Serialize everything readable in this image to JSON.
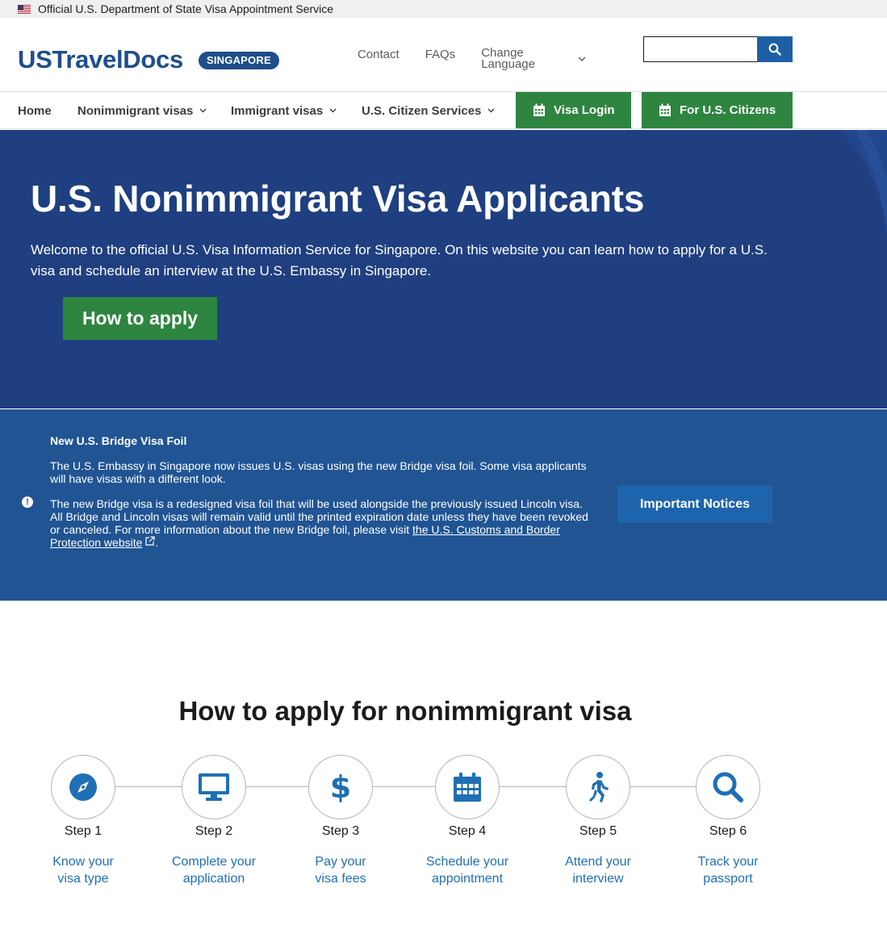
{
  "banner": {
    "text": "Official U.S. Department of State Visa Appointment Service"
  },
  "header": {
    "logo": "USTravelDocs",
    "country": "SINGAPORE",
    "contact": "Contact",
    "faqs": "FAQs",
    "language_line1": "Change",
    "language_line2": "Language",
    "search_value": ""
  },
  "nav": {
    "home": "Home",
    "nonimmigrant": "Nonimmigrant visas",
    "immigrant": "Immigrant visas",
    "citizen_services": "U.S. Citizen Services",
    "visa_login": "Visa Login",
    "for_citizens": "For U.S. Citizens"
  },
  "hero": {
    "title": "U.S. Nonimmigrant Visa Applicants",
    "text": "Welcome to the official U.S. Visa Information Service for Singapore. On this website you can learn how to apply for a U.S. visa and schedule an interview at the U.S. Embassy in Singapore.",
    "button": "How to apply"
  },
  "notice": {
    "heading": "New U.S. Bridge Visa Foil",
    "p1": "The U.S. Embassy in Singapore now issues U.S. visas using the new Bridge visa foil. Some visa applicants will have visas with a different look.",
    "p2": "The new Bridge visa is a redesigned visa foil that will be used alongside the previously issued Lincoln visa. All Bridge and Lincoln visas will remain valid until the printed expiration date unless they have been revoked or canceled. For more information about the new Bridge foil, please visit ",
    "link": "the U.S. Customs and Border Protection website",
    "p2_end": ".",
    "button": "Important Notices"
  },
  "steps": {
    "title": "How to apply for nonimmigrant visa",
    "items": [
      {
        "step": "Step 1",
        "line1": "Know your",
        "line2": "visa type",
        "icon": "compass-icon"
      },
      {
        "step": "Step 2",
        "line1": "Complete your",
        "line2": "application",
        "icon": "monitor-icon"
      },
      {
        "step": "Step 3",
        "line1": "Pay your",
        "line2": "visa fees",
        "icon": "dollar-icon"
      },
      {
        "step": "Step 4",
        "line1": "Schedule your",
        "line2": "appointment",
        "icon": "calendar-icon"
      },
      {
        "step": "Step 5",
        "line1": "Attend your",
        "line2": "interview",
        "icon": "walking-person-icon"
      },
      {
        "step": "Step 6",
        "line1": "Track your",
        "line2": "passport",
        "icon": "magnifier-icon"
      }
    ]
  },
  "colors": {
    "brand_blue": "#1f4e8c",
    "hero_blue": "#1f3f80",
    "notice_blue": "#205493",
    "green": "#2e8540",
    "link_blue": "#1f6fb5"
  }
}
